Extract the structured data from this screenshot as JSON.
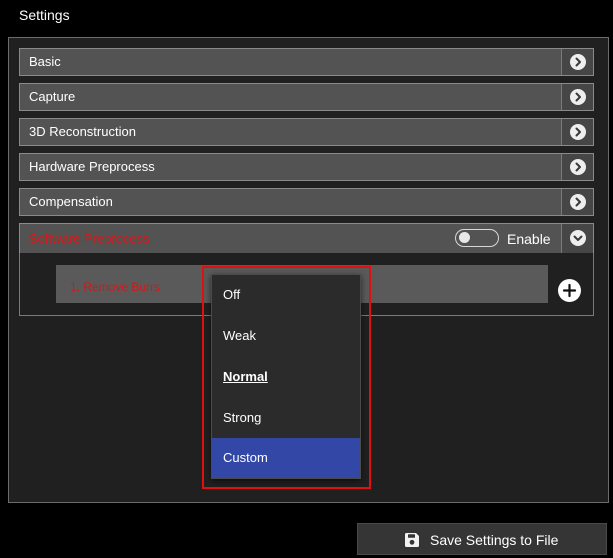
{
  "window": {
    "title": "Settings"
  },
  "sections": [
    {
      "label": "Basic"
    },
    {
      "label": "Capture"
    },
    {
      "label": "3D Reconstruction"
    },
    {
      "label": "Hardware Preprocess"
    },
    {
      "label": "Compensation"
    },
    {
      "label": "Software Preprocess"
    }
  ],
  "software_preprocess": {
    "toggle_label": "Enable",
    "toggle_on": false,
    "steps": [
      {
        "label": "1. Remove Burrs"
      }
    ],
    "add_icon": "plus-circle-icon"
  },
  "dropdown": {
    "options": [
      "Off",
      "Weak",
      "Normal",
      "Strong",
      "Custom"
    ],
    "selected": "Normal",
    "hovered": "Custom"
  },
  "footer": {
    "save_label": "Save Settings to File",
    "save_icon": "floppy-disk-icon"
  },
  "colors": {
    "accent_red": "#d41818",
    "highlight_blue": "#3348a6",
    "annotation_red": "#e01010"
  }
}
